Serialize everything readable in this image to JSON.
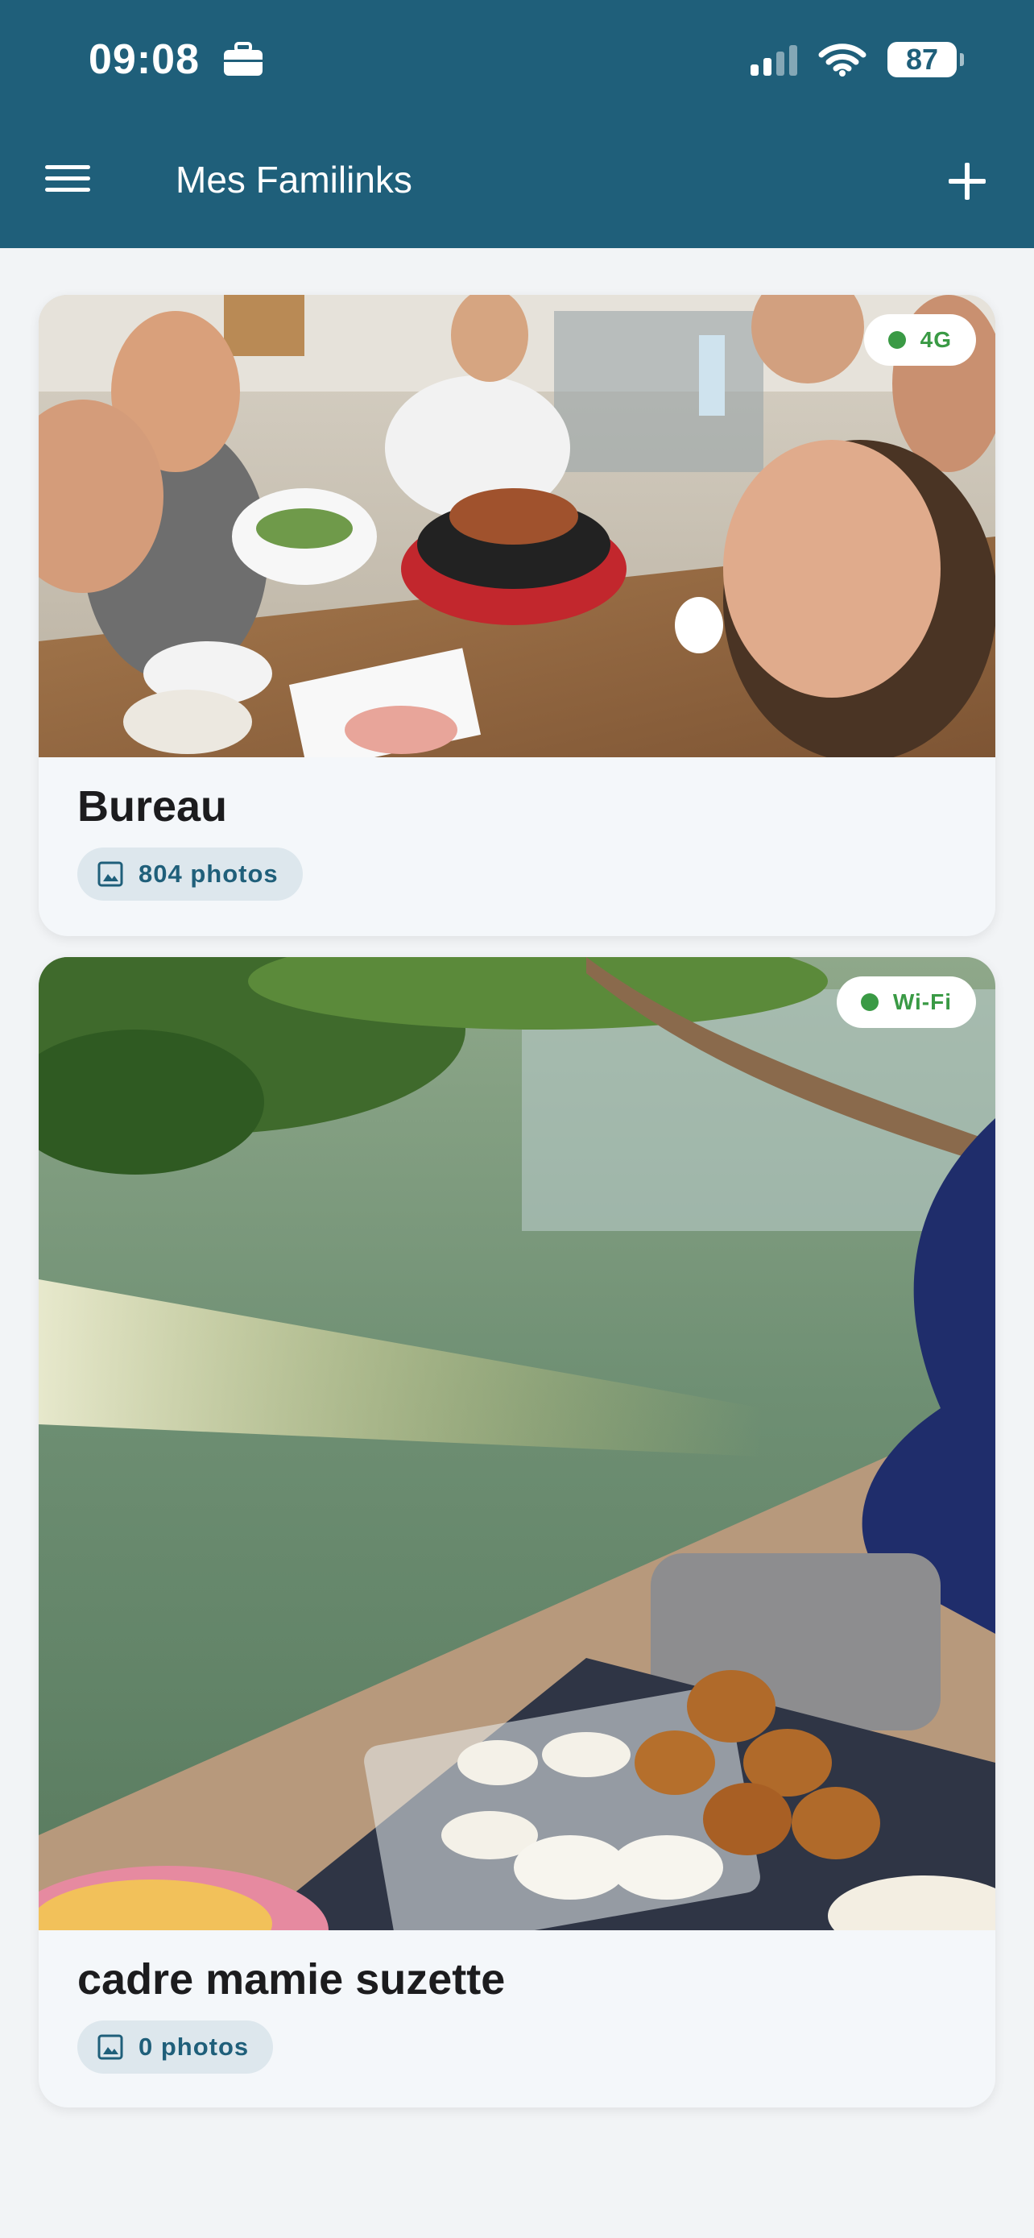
{
  "status_bar": {
    "time": "09:08",
    "battery": "87",
    "icons": [
      "briefcase-icon",
      "signal-icon",
      "wifi-icon",
      "battery-icon"
    ]
  },
  "app_bar": {
    "title": "Mes Familinks",
    "menu_icon": "hamburger-menu-icon",
    "add_icon": "plus-icon"
  },
  "frames": [
    {
      "name": "Bureau",
      "photo_count_label": "804 photos",
      "network": "4G"
    },
    {
      "name": "cadre mamie suzette",
      "photo_count_label": "0 photos",
      "network": "Wi-Fi"
    }
  ],
  "colors": {
    "brand": "#1f5f7a",
    "online": "#3a9a45",
    "chip_bg": "#dde7ed",
    "background": "#f2f4f6"
  }
}
